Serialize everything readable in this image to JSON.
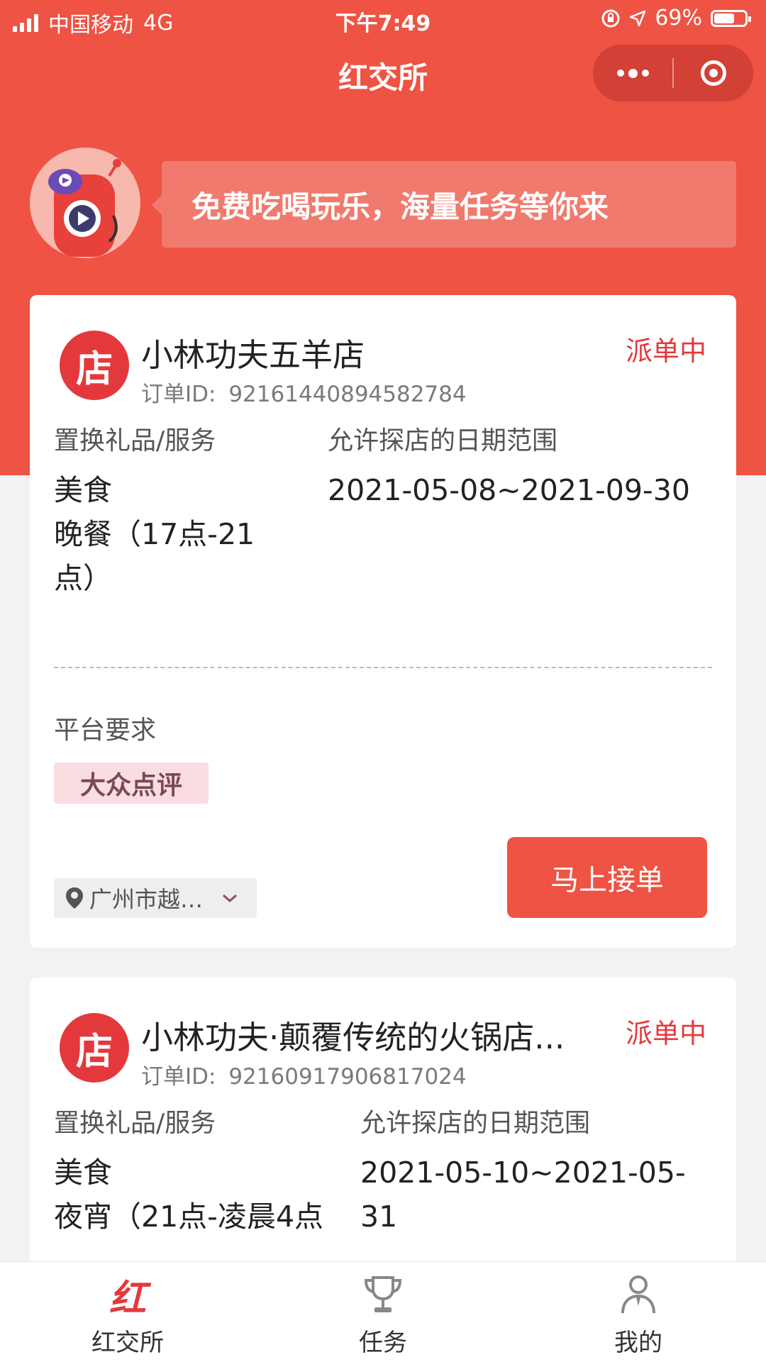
{
  "status_bar": {
    "carrier": "中国移动",
    "network": "4G",
    "time": "下午7:49",
    "battery_percent": "69%",
    "battery_level": 0.69
  },
  "nav": {
    "title": "红交所"
  },
  "banner": {
    "text": "免费吃喝玩乐，海量任务等你来"
  },
  "orders": [
    {
      "shop_icon": "店",
      "shop_name": "小林功夫五羊店",
      "order_id_label": "订单ID:",
      "order_id": "92161440894582784",
      "status": "派单中",
      "gift_label": "置换礼品/服务",
      "gift_category": "美食",
      "gift_detail": "晚餐（17点-21点）",
      "date_label": "允许探店的日期范围",
      "date_range": "2021-05-08~2021-09-30",
      "requirement_label": "平台要求",
      "platform": "大众点评",
      "location": "广州市越…",
      "accept_label": "马上接单"
    },
    {
      "shop_icon": "店",
      "shop_name": "小林功夫·颠覆传统的火锅店...",
      "order_id_label": "订单ID:",
      "order_id": "92160917906817024",
      "status": "派单中",
      "gift_label": "置换礼品/服务",
      "gift_category": "美食",
      "gift_detail": "夜宵（21点-凌晨4点",
      "date_label": "允许探店的日期范围",
      "date_range": "2021-05-10~2021-05-31"
    }
  ],
  "tab_bar": {
    "active_color": "#e4393c",
    "items": [
      {
        "label": "红交所",
        "icon": "hongjiaosuo-logo-icon"
      },
      {
        "label": "任务",
        "icon": "trophy-icon"
      },
      {
        "label": "我的",
        "icon": "user-icon"
      }
    ]
  }
}
